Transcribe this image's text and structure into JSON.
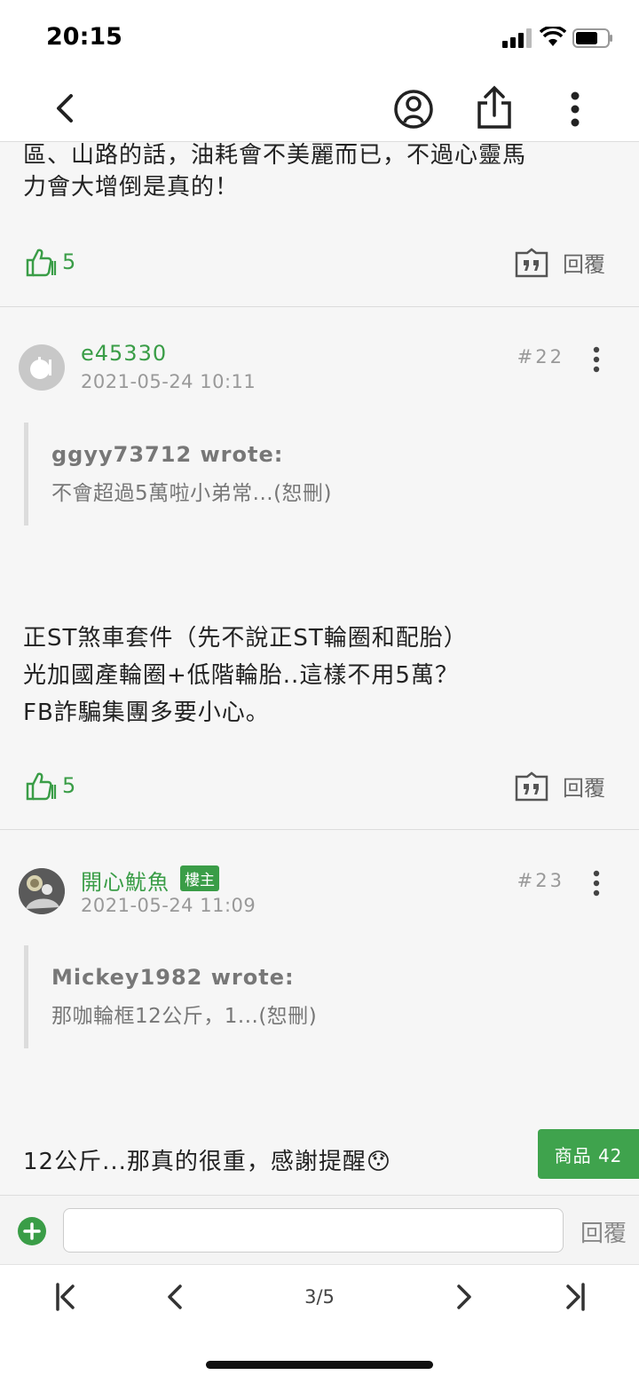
{
  "status_bar": {
    "time": "20:15"
  },
  "prev_post": {
    "text_lines": [
      "區、山路的話，油耗會不美麗而已，不過心靈馬",
      "力會大增倒是真的！"
    ],
    "likes": "5",
    "reply_label": "回覆"
  },
  "posts": [
    {
      "author": "e45330",
      "date": "2021-05-24 10:11",
      "floor": "#22",
      "quote_author": "ggyy73712 wrote:",
      "quote_text": "不會超過5萬啦小弟常...(恕刪)",
      "body_lines": [
        "正ST煞車套件（先不說正ST輪圈和配胎）",
        "光加國產輪圈+低階輪胎..這樣不用5萬？",
        "FB詐騙集團多要小心。"
      ],
      "likes": "5",
      "reply_label": "回覆"
    },
    {
      "author": "開心魷魚",
      "badge": "樓主",
      "date": "2021-05-24 11:09",
      "floor": "#23",
      "quote_author": "Mickey1982 wrote:",
      "quote_text": "那咖輪框12公斤，1...(恕刪)",
      "body_lines": [
        "12公斤...那真的很重，感謝提醒😯"
      ]
    }
  ],
  "product_badge": "商品 42",
  "reply_bar": {
    "placeholder": "",
    "send_label": "回覆"
  },
  "pagination": {
    "page_label": "3/5"
  },
  "colors": {
    "accent": "#3a9d47",
    "badge": "#3fa34d"
  }
}
